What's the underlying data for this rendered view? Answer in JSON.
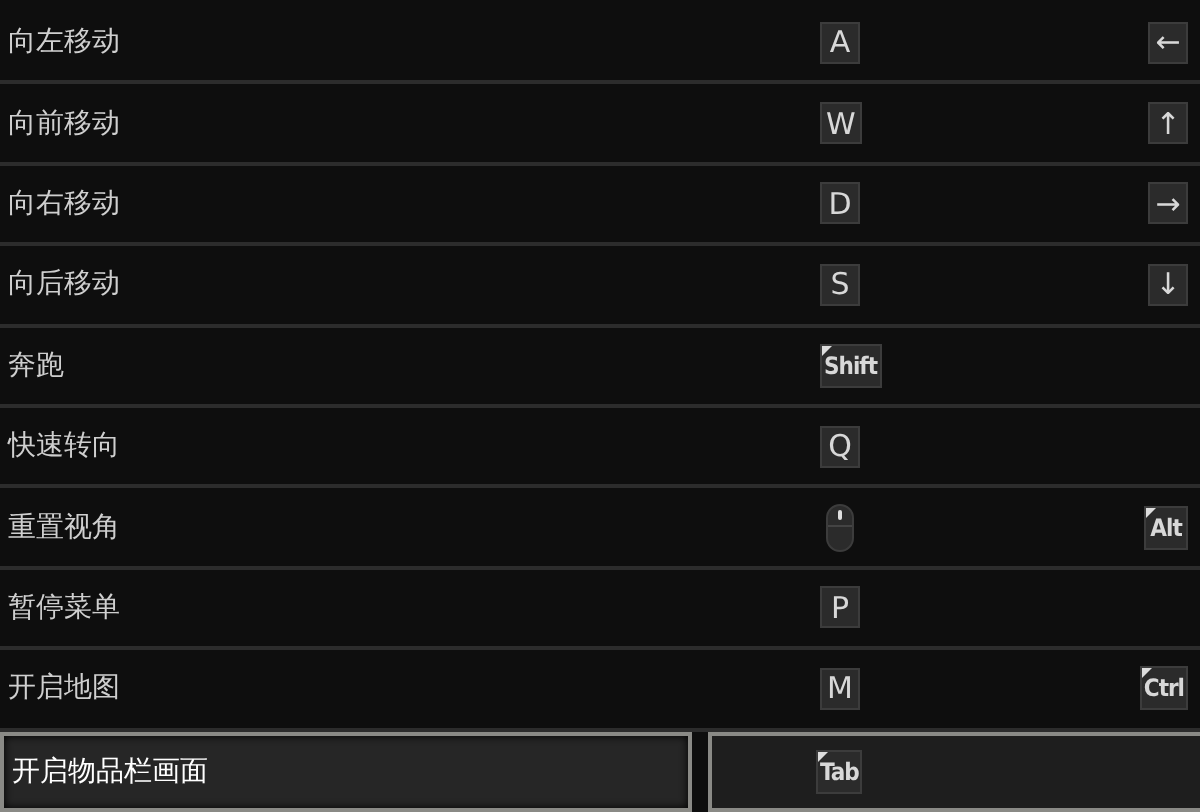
{
  "bindings": [
    {
      "action": "向左移动",
      "selected": false,
      "primary": {
        "kind": "key",
        "label": "A"
      },
      "secondary": {
        "kind": "key",
        "label": "←"
      }
    },
    {
      "action": "向前移动",
      "selected": false,
      "primary": {
        "kind": "key",
        "label": "W"
      },
      "secondary": {
        "kind": "key",
        "label": "↑"
      }
    },
    {
      "action": "向右移动",
      "selected": false,
      "primary": {
        "kind": "key",
        "label": "D"
      },
      "secondary": {
        "kind": "key",
        "label": "→"
      }
    },
    {
      "action": "向后移动",
      "selected": false,
      "primary": {
        "kind": "key",
        "label": "S"
      },
      "secondary": {
        "kind": "key",
        "label": "↓"
      }
    },
    {
      "action": "奔跑",
      "selected": false,
      "primary": {
        "kind": "modifier",
        "label": "Shift"
      }
    },
    {
      "action": "快速转向",
      "selected": false,
      "primary": {
        "kind": "key",
        "label": "Q"
      }
    },
    {
      "action": "重置视角",
      "selected": false,
      "primary": {
        "kind": "mouse"
      },
      "secondary": {
        "kind": "modifier",
        "label": "Alt"
      }
    },
    {
      "action": "暂停菜单",
      "selected": false,
      "primary": {
        "kind": "key",
        "label": "P"
      }
    },
    {
      "action": "开启地图",
      "selected": false,
      "primary": {
        "kind": "key",
        "label": "M"
      },
      "secondary": {
        "kind": "modifier",
        "label": "Ctrl"
      }
    },
    {
      "action": "开启物品栏画面",
      "selected": true,
      "primary": {
        "kind": "modifier",
        "label": "Tab"
      }
    }
  ]
}
